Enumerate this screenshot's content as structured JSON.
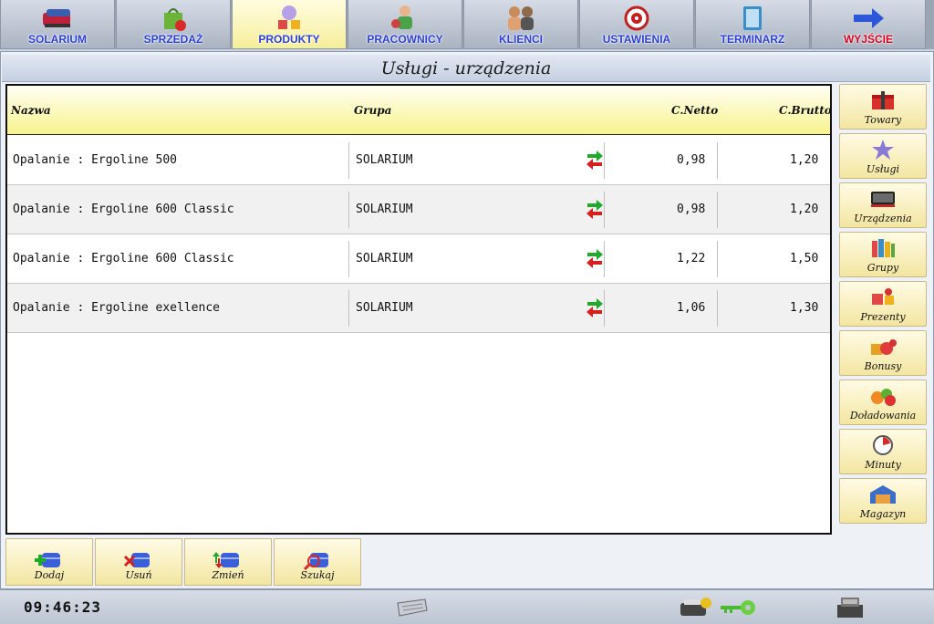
{
  "nav": {
    "tabs": [
      {
        "label": "SOLARIUM",
        "icon": "solarium-bed-icon"
      },
      {
        "label": "SPRZEDAŻ",
        "icon": "shopping-bag-icon"
      },
      {
        "label": "PRODUKTY",
        "icon": "products-icon",
        "active": true
      },
      {
        "label": "PRACOWNICY",
        "icon": "employees-icon"
      },
      {
        "label": "KLIENCI",
        "icon": "clients-icon"
      },
      {
        "label": "USTAWIENIA",
        "icon": "settings-target-icon"
      },
      {
        "label": "TERMINARZ",
        "icon": "calendar-book-icon"
      },
      {
        "label": "WYJŚCIE",
        "icon": "exit-arrow-icon"
      }
    ]
  },
  "page": {
    "title": "Usługi - urządzenia"
  },
  "table": {
    "headers": {
      "name": "Nazwa",
      "group": "Grupa",
      "net": "C.Netto",
      "gross": "C.Brutto"
    },
    "rows": [
      {
        "name": "Opalanie : Ergoline 500",
        "group": "SOLARIUM",
        "net": "0,98",
        "gross": "1,20"
      },
      {
        "name": "Opalanie : Ergoline 600 Classic",
        "group": "SOLARIUM",
        "net": "0,98",
        "gross": "1,20"
      },
      {
        "name": "Opalanie : Ergoline 600 Classic",
        "group": "SOLARIUM",
        "net": "1,22",
        "gross": "1,50"
      },
      {
        "name": "Opalanie : Ergoline exellence",
        "group": "SOLARIUM",
        "net": "1,06",
        "gross": "1,30"
      }
    ]
  },
  "side": {
    "buttons": [
      {
        "label": "Towary",
        "icon": "goods-box-icon"
      },
      {
        "label": "Usługi",
        "icon": "services-star-icon"
      },
      {
        "label": "Urządzenia",
        "icon": "device-icon"
      },
      {
        "label": "Grupy",
        "icon": "groups-books-icon"
      },
      {
        "label": "Prezenty",
        "icon": "gifts-icon"
      },
      {
        "label": "Bonusy",
        "icon": "bonus-icon"
      },
      {
        "label": "Doładowania",
        "icon": "topup-icon"
      },
      {
        "label": "Minuty",
        "icon": "minutes-clock-icon"
      },
      {
        "label": "Magazyn",
        "icon": "warehouse-icon"
      }
    ]
  },
  "actions": {
    "add": "Dodaj",
    "delete": "Usuń",
    "edit": "Zmień",
    "search": "Szukaj"
  },
  "status": {
    "clock": "09:46:23"
  },
  "colors": {
    "nav_label": "#2b3fd6",
    "exit_label": "#d8001c",
    "header_yellow": "#f7f38d",
    "button_yellow": "#f3e6a0"
  }
}
